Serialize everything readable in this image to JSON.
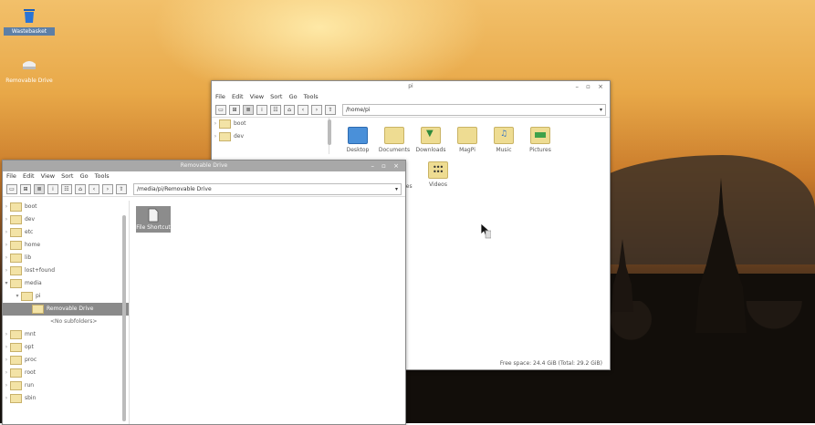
{
  "desktop": {
    "icons": [
      {
        "label": "Wastebasket",
        "icon": "trash-icon"
      },
      {
        "label": "Removable Drive",
        "icon": "drive-icon"
      }
    ]
  },
  "window_home": {
    "title": "pi",
    "menu": [
      "File",
      "Edit",
      "View",
      "Sort",
      "Go",
      "Tools"
    ],
    "path": "/home/pi",
    "tree": [
      "boot",
      "dev"
    ],
    "items": [
      {
        "label": "Desktop",
        "icon": "desktop-folder-icon",
        "color": "#4a90d9"
      },
      {
        "label": "Documents",
        "icon": "documents-folder-icon",
        "color": "#e8d68a"
      },
      {
        "label": "Downloads",
        "icon": "downloads-folder-icon",
        "color": "#3fa24a"
      },
      {
        "label": "MagPi",
        "icon": "folder-icon",
        "color": "#eedc92"
      },
      {
        "label": "Music",
        "icon": "music-folder-icon",
        "color": "#3e7fd1"
      },
      {
        "label": "Pictures",
        "icon": "pictures-folder-icon",
        "color": "#3fa24a"
      },
      {
        "label": "…tes",
        "icon": "templates-folder-icon",
        "color": "#eedc92"
      },
      {
        "label": "Videos",
        "icon": "videos-folder-icon",
        "color": "#333333"
      }
    ],
    "status": "Free space: 24.4 GiB (Total: 29.2 GiB)"
  },
  "window_drive": {
    "title": "Removable Drive",
    "menu": [
      "File",
      "Edit",
      "View",
      "Sort",
      "Go",
      "Tools"
    ],
    "path": "/media/pi/Removable Drive",
    "tree": [
      {
        "label": "boot",
        "arrow": "›"
      },
      {
        "label": "dev",
        "arrow": "›"
      },
      {
        "label": "etc",
        "arrow": "›"
      },
      {
        "label": "home",
        "arrow": "›"
      },
      {
        "label": "lib",
        "arrow": "›"
      },
      {
        "label": "lost+found",
        "arrow": "›"
      },
      {
        "label": "media",
        "arrow": "▾"
      },
      {
        "label": "pi",
        "arrow": "▾"
      },
      {
        "label": "Removable Drive",
        "arrow": ""
      },
      {
        "label": "<No subfolders>",
        "arrow": ""
      },
      {
        "label": "mnt",
        "arrow": "›"
      },
      {
        "label": "opt",
        "arrow": "›"
      },
      {
        "label": "proc",
        "arrow": "›"
      },
      {
        "label": "root",
        "arrow": "›"
      },
      {
        "label": "run",
        "arrow": "›"
      },
      {
        "label": "sbin",
        "arrow": "›"
      }
    ],
    "file": {
      "label": "File Shortcut",
      "icon": "file-icon"
    }
  }
}
